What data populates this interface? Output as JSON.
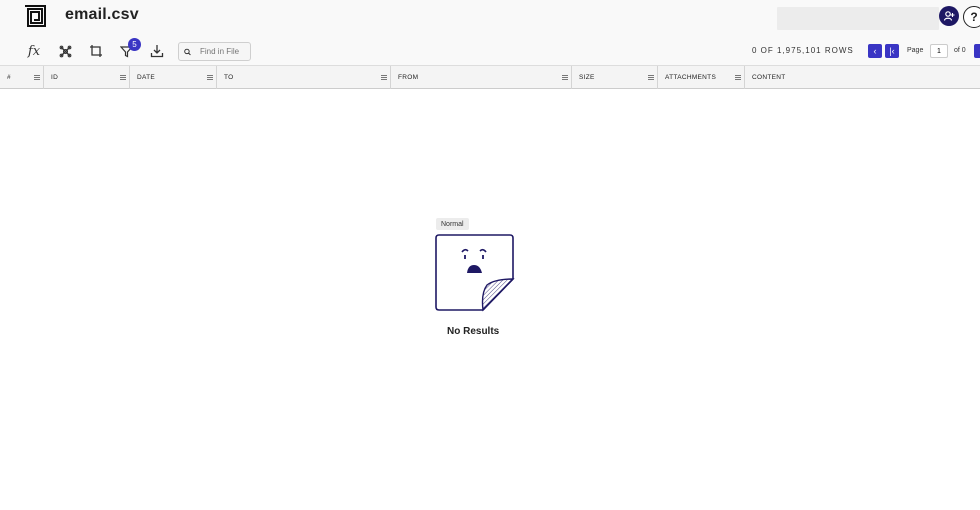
{
  "app": {
    "title": "email.csv",
    "logo_icon": "square-spiral-logo-icon"
  },
  "header_actions": {
    "user_icon": "add-user-icon",
    "help_label": "?"
  },
  "toolbar": {
    "tools": [
      "fx-icon",
      "pivot-icon",
      "frame-icon",
      "filter-icon",
      "download-icon"
    ],
    "fx_label": "fx",
    "filter_badge": "5",
    "find_placeholder": "Find in File"
  },
  "pagination": {
    "rows_text": "0 OF 1,975,101 ROWS",
    "page_label": "Page",
    "page_value": "1",
    "of_label": "of 0"
  },
  "table": {
    "columns": [
      "#",
      "ID",
      "DATE",
      "TO",
      "FROM",
      "SIZE",
      "ATTACHMENTS",
      "CONTENT"
    ]
  },
  "empty_state": {
    "tooltip": "Normal",
    "message": "No Results",
    "icon": "sad-note-icon"
  },
  "colors": {
    "accent": "#3a35c4",
    "user_button": "#1e1864",
    "note_border": "#1e1864"
  }
}
